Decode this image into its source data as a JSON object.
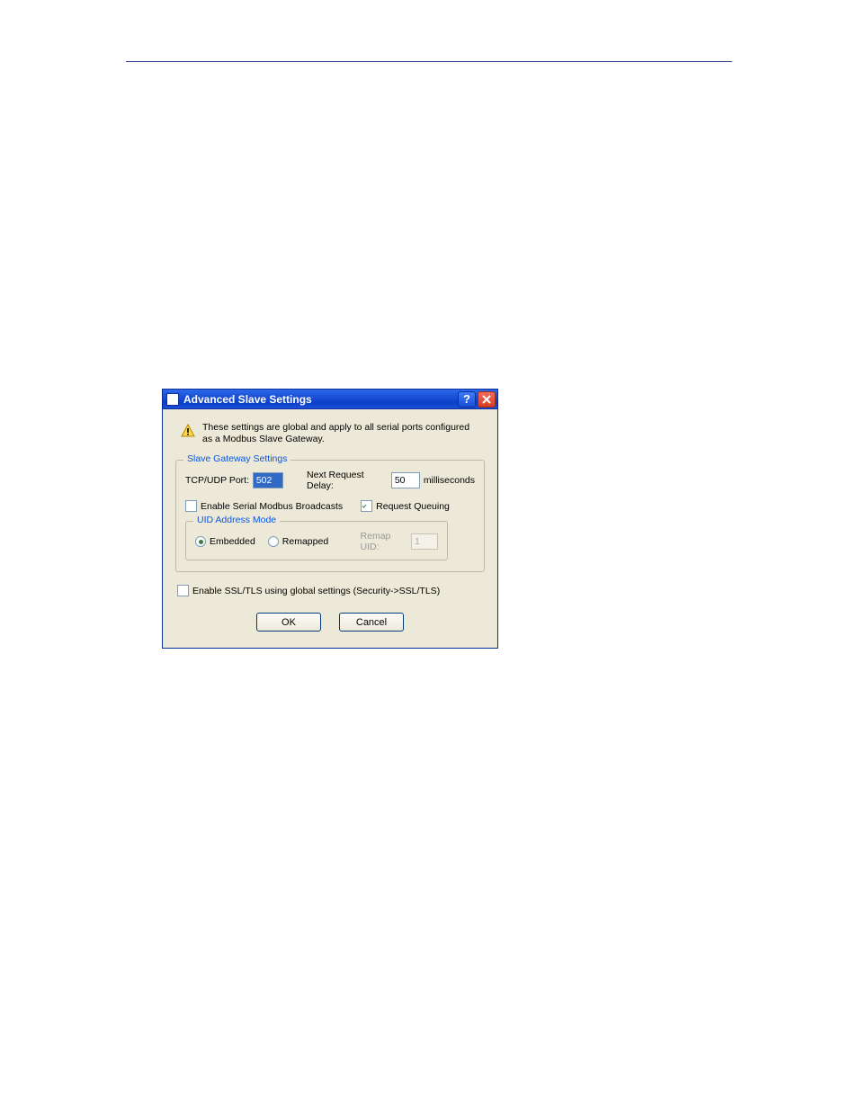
{
  "dialog": {
    "title": "Advanced Slave Settings",
    "warning": "These settings are global and apply to all serial ports configured as a Modbus Slave Gateway.",
    "group": {
      "title": "Slave Gateway Settings",
      "port_label": "TCP/UDP Port:",
      "port_value": "502",
      "delay_label": "Next Request Delay:",
      "delay_value": "50",
      "delay_unit": "milliseconds",
      "broadcast_label": "Enable Serial Modbus Broadcasts",
      "queuing_label": "Request Queuing",
      "uid_group_title": "UID Address Mode",
      "radio_embedded": "Embedded",
      "radio_remapped": "Remapped",
      "remap_label": "Remap UID:",
      "remap_value": "1"
    },
    "ssl_label": "Enable SSL/TLS using global settings (Security->SSL/TLS)",
    "ok": "OK",
    "cancel": "Cancel"
  }
}
